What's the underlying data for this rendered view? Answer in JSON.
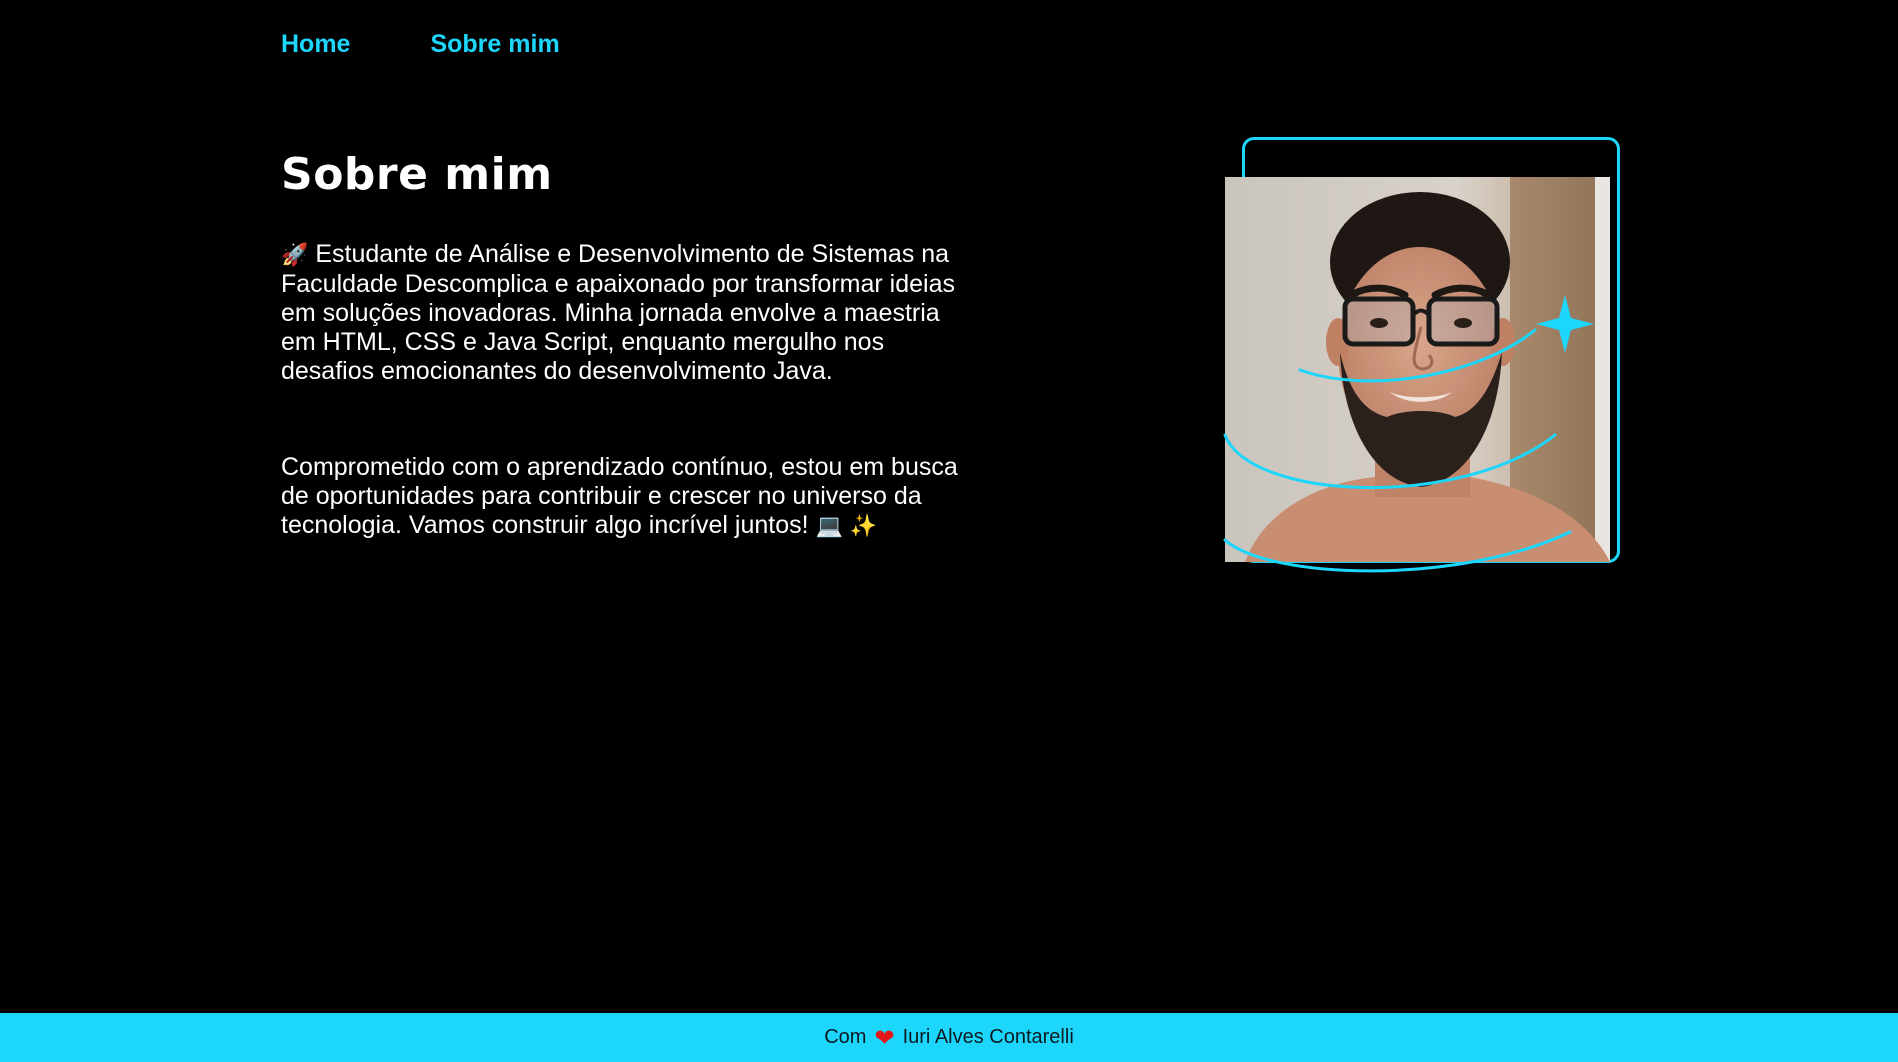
{
  "nav": {
    "items": [
      {
        "label": "Home"
      },
      {
        "label": "Sobre mim"
      }
    ]
  },
  "main": {
    "title": "Sobre mim",
    "paragraph1": {
      "emoji": "🚀",
      "text": "Estudante de Análise e Desenvolvimento de Sistemas na Faculdade Descomplica e apaixonado por transformar ideias em soluções inovadoras. Minha jornada envolve a maestria em HTML, CSS e Java Script, enquanto mergulho nos desafios emocionantes do desenvolvimento Java."
    },
    "paragraph2": {
      "text": "Comprometido com o aprendizado contínuo, estou em busca de oportunidades para contribuir e crescer no universo da tecnologia. Vamos construir algo incrível juntos!",
      "emoji_laptop": "💻",
      "emoji_sparkles": "✨"
    }
  },
  "footer": {
    "prefix": "Com",
    "heart": "❤",
    "author": "Iuri Alves Contarelli"
  },
  "colors": {
    "accent": "#1cd6fc",
    "background": "#000000",
    "heart": "#e21818"
  }
}
